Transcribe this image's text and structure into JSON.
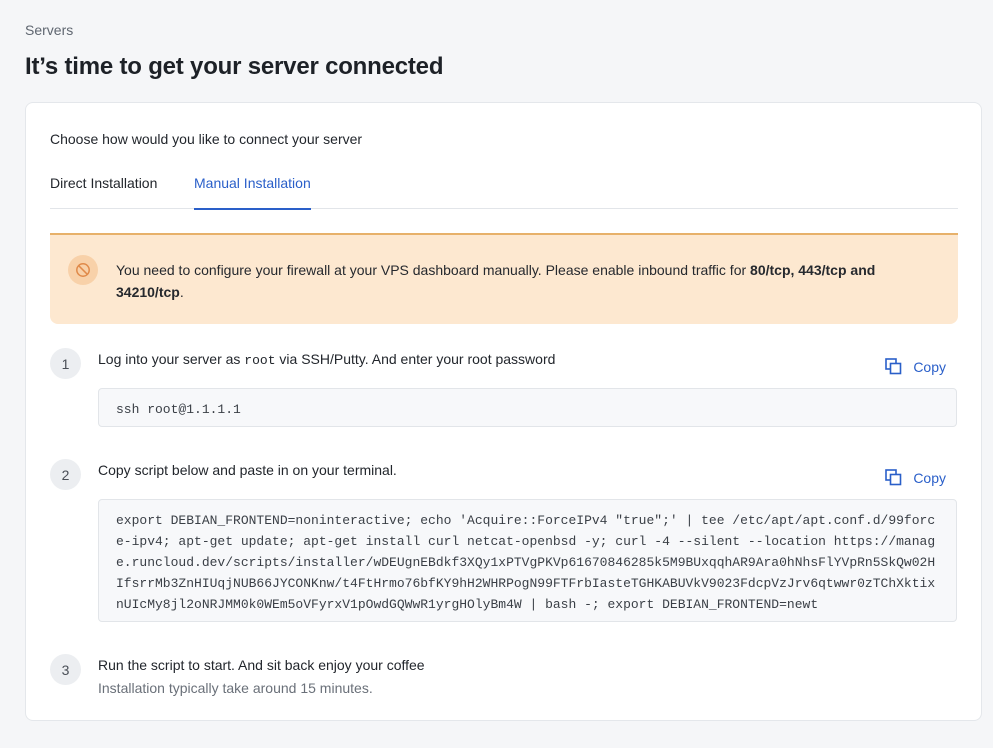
{
  "breadcrumb": "Servers",
  "page_title": "It’s time to get your server connected",
  "card": {
    "heading": "Choose how would you like to connect your server",
    "tabs": [
      {
        "label": "Direct Installation",
        "active": false
      },
      {
        "label": "Manual Installation",
        "active": true
      }
    ]
  },
  "alert": {
    "icon": "forbidden-icon",
    "text_prefix": "You need to configure your firewall at your VPS dashboard manually. Please enable inbound traffic for ",
    "text_bold": "80/tcp, 443/tcp and 34210/tcp",
    "text_suffix": ".",
    "colors": {
      "background": "#fde8d0",
      "border": "#e7b16a"
    }
  },
  "steps": [
    {
      "number": "1",
      "title_prefix": "Log into your server as ",
      "title_code": "root",
      "title_suffix": " via SSH/Putty. And enter your root password",
      "copy_label": "Copy",
      "code": "ssh root@1.1.1.1"
    },
    {
      "number": "2",
      "title": "Copy script below and paste in on your terminal.",
      "copy_label": "Copy",
      "code": "export DEBIAN_FRONTEND=noninteractive; echo 'Acquire::ForceIPv4 \"true\";' | tee /etc/apt/apt.conf.d/99force-ipv4; apt-get update; apt-get install curl netcat-openbsd -y; curl -4 --silent --location https://manage.runcloud.dev/scripts/installer/wDEUgnEBdkf3XQy1xPTVgPKVp61670846285k5M9BUxqqhAR9Ara0hNhsFlYVpRn5SkQw02HIfsrrMb3ZnHIUqjNUB66JYCONKnw/t4FtHrmo76bfKY9hH2WHRPogN99FTFrbIasteTGHKABUVkV9023FdcpVzJrv6qtwwr0zTChXktixnUIcMy8jl2oNRJMM0k0WEm5oVFyrxV1pOwdGQWwR1yrgHOlyBm4W | bash -; export DEBIAN_FRONTEND=newt"
    },
    {
      "number": "3",
      "title": "Run the script to start. And sit back enjoy your coffee",
      "subtitle": "Installation typically take around 15 minutes."
    }
  ],
  "colors": {
    "accent": "#2a5fc9",
    "page_bg": "#f5f6f8"
  }
}
